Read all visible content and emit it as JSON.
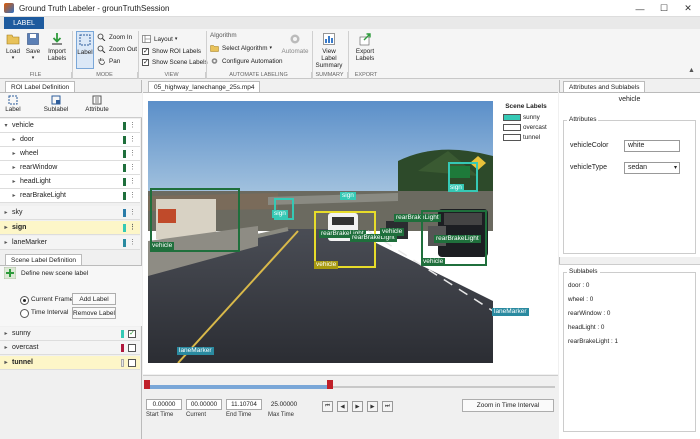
{
  "window": {
    "title": "Ground Truth Labeler - grounTruthSession"
  },
  "ribbon": {
    "tab": "LABEL",
    "file": {
      "load": "Load",
      "save": "Save",
      "import": "Import",
      "import2": "Labels",
      "section": "FILE"
    },
    "mode": {
      "label": "Label",
      "zoom_in": "Zoom In",
      "zoom_out": "Zoom Out",
      "pan": "Pan",
      "section": "MODE"
    },
    "view": {
      "layout": "Layout",
      "show_roi": "Show ROI Labels",
      "show_scene": "Show Scene Labels",
      "section": "VIEW"
    },
    "algo": {
      "header": "Algorithm",
      "select": "Select Algorithm",
      "configure": "Configure Automation",
      "automate": "Automate",
      "section": "AUTOMATE LABELING"
    },
    "summary": {
      "label1": "View Label",
      "label2": "Summary",
      "section": "SUMMARY"
    },
    "export": {
      "label1": "Export",
      "label2": "Labels",
      "section": "EXPORT"
    }
  },
  "roi_panel": {
    "tab": "ROI Label Definition",
    "tools": [
      "Label",
      "Sublabel",
      "Attribute"
    ],
    "items": [
      {
        "name": "vehicle",
        "color": "#1f6f3c"
      },
      {
        "name": "door",
        "color": "#1f6f3c"
      },
      {
        "name": "wheel",
        "color": "#1f6f3c"
      },
      {
        "name": "rearWindow",
        "color": "#1f6f3c"
      },
      {
        "name": "headLight",
        "color": "#1f6f3c"
      },
      {
        "name": "rearBrakeLight",
        "color": "#1f6f3c"
      },
      {
        "name": "sky",
        "color": "#2a7ca8"
      },
      {
        "name": "sign",
        "color": "#35c9b5"
      },
      {
        "name": "laneMarker",
        "color": "#2a8aa0"
      }
    ]
  },
  "scene_panel": {
    "tab": "Scene Label Definition",
    "define": "Define new scene label",
    "current_frame": "Current Frame",
    "time_interval": "Time Interval",
    "add": "Add Label",
    "remove": "Remove Label",
    "items": [
      {
        "name": "sunny",
        "color": "#35c9b5",
        "checked": true
      },
      {
        "name": "overcast",
        "color": "#b0173c",
        "checked": false
      },
      {
        "name": "tunnel",
        "color": "#e8e8e8",
        "checked": false
      }
    ]
  },
  "video": {
    "tab": "05_highway_lanechange_25s.mp4",
    "scene_labels_header": "Scene Labels",
    "scene_labels": [
      "sunny",
      "overcast",
      "tunnel"
    ],
    "box_labels": {
      "vehicle": "vehicle",
      "sign": "sign",
      "rearBrakeLight": "rearBrakeLight",
      "laneMarker": "laneMarker"
    }
  },
  "timeline": {
    "start_time": "0.00000",
    "current": "00.00000",
    "end_time": "11.10704",
    "max_time": "25.00000",
    "start_cap": "Start Time",
    "current_cap": "Current",
    "end_cap": "End Time",
    "max_cap": "Max Time",
    "zoom": "Zoom in Time Interval"
  },
  "attributes": {
    "tab": "Attributes and Sublabels",
    "heading": "vehicle",
    "section": "Attributes",
    "color_label": "vehicleColor",
    "color_value": "white",
    "type_label": "vehicleType",
    "type_value": "sedan",
    "sublabels_section": "Sublabels",
    "sublabels": [
      "door : 0",
      "wheel : 0",
      "rearWindow : 0",
      "headLight : 0",
      "rearBrakeLight : 1"
    ]
  }
}
